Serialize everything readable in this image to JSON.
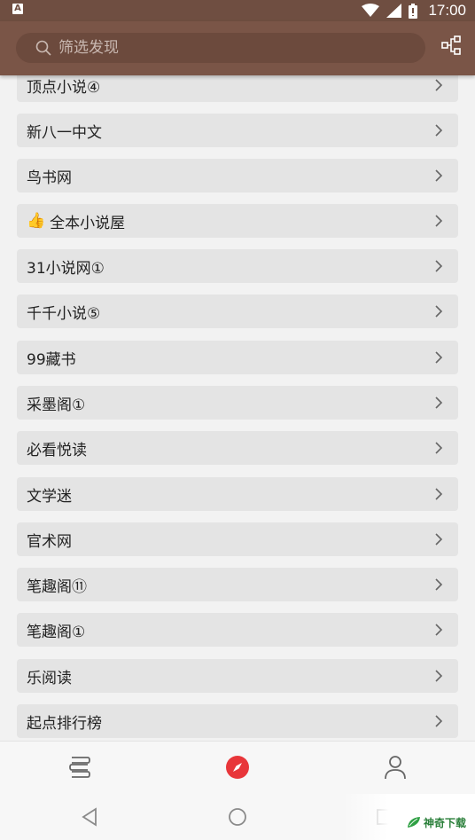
{
  "status_bar": {
    "time": "17:00",
    "icons": [
      "notification-a-icon",
      "wifi-icon",
      "signal-icon",
      "battery-icon"
    ]
  },
  "toolbar": {
    "search_placeholder": "筛选发现",
    "search_icon": "search-icon",
    "right_icon": "group-tree-icon"
  },
  "sources": [
    {
      "label": "顶点小说④"
    },
    {
      "label": "新八一中文"
    },
    {
      "label": "鸟书网"
    },
    {
      "label": "全本小说屋",
      "icon": "👍"
    },
    {
      "label": "31小说网①"
    },
    {
      "label": "千千小说⑤"
    },
    {
      "label": "99藏书"
    },
    {
      "label": "采墨阁①"
    },
    {
      "label": "必看悦读"
    },
    {
      "label": "文学迷"
    },
    {
      "label": "官术网"
    },
    {
      "label": "笔趣阁⑪"
    },
    {
      "label": "笔趣阁①"
    },
    {
      "label": "乐阅读"
    },
    {
      "label": "起点排行榜"
    }
  ],
  "bottom_nav": {
    "items": [
      {
        "icon": "bookshelf-icon",
        "active": false
      },
      {
        "icon": "discover-compass-icon",
        "active": true
      },
      {
        "icon": "profile-icon",
        "active": false
      }
    ],
    "active_color": "#e8363a"
  },
  "system_nav": [
    "back-icon",
    "home-icon",
    "recents-icon"
  ],
  "watermark": {
    "text": "神奇下载"
  },
  "colors": {
    "toolbar": "#7a5547",
    "status_bar": "#6f4e41",
    "list_item_bg": "#e4e4e4",
    "page_bg": "#f2f2f2"
  }
}
